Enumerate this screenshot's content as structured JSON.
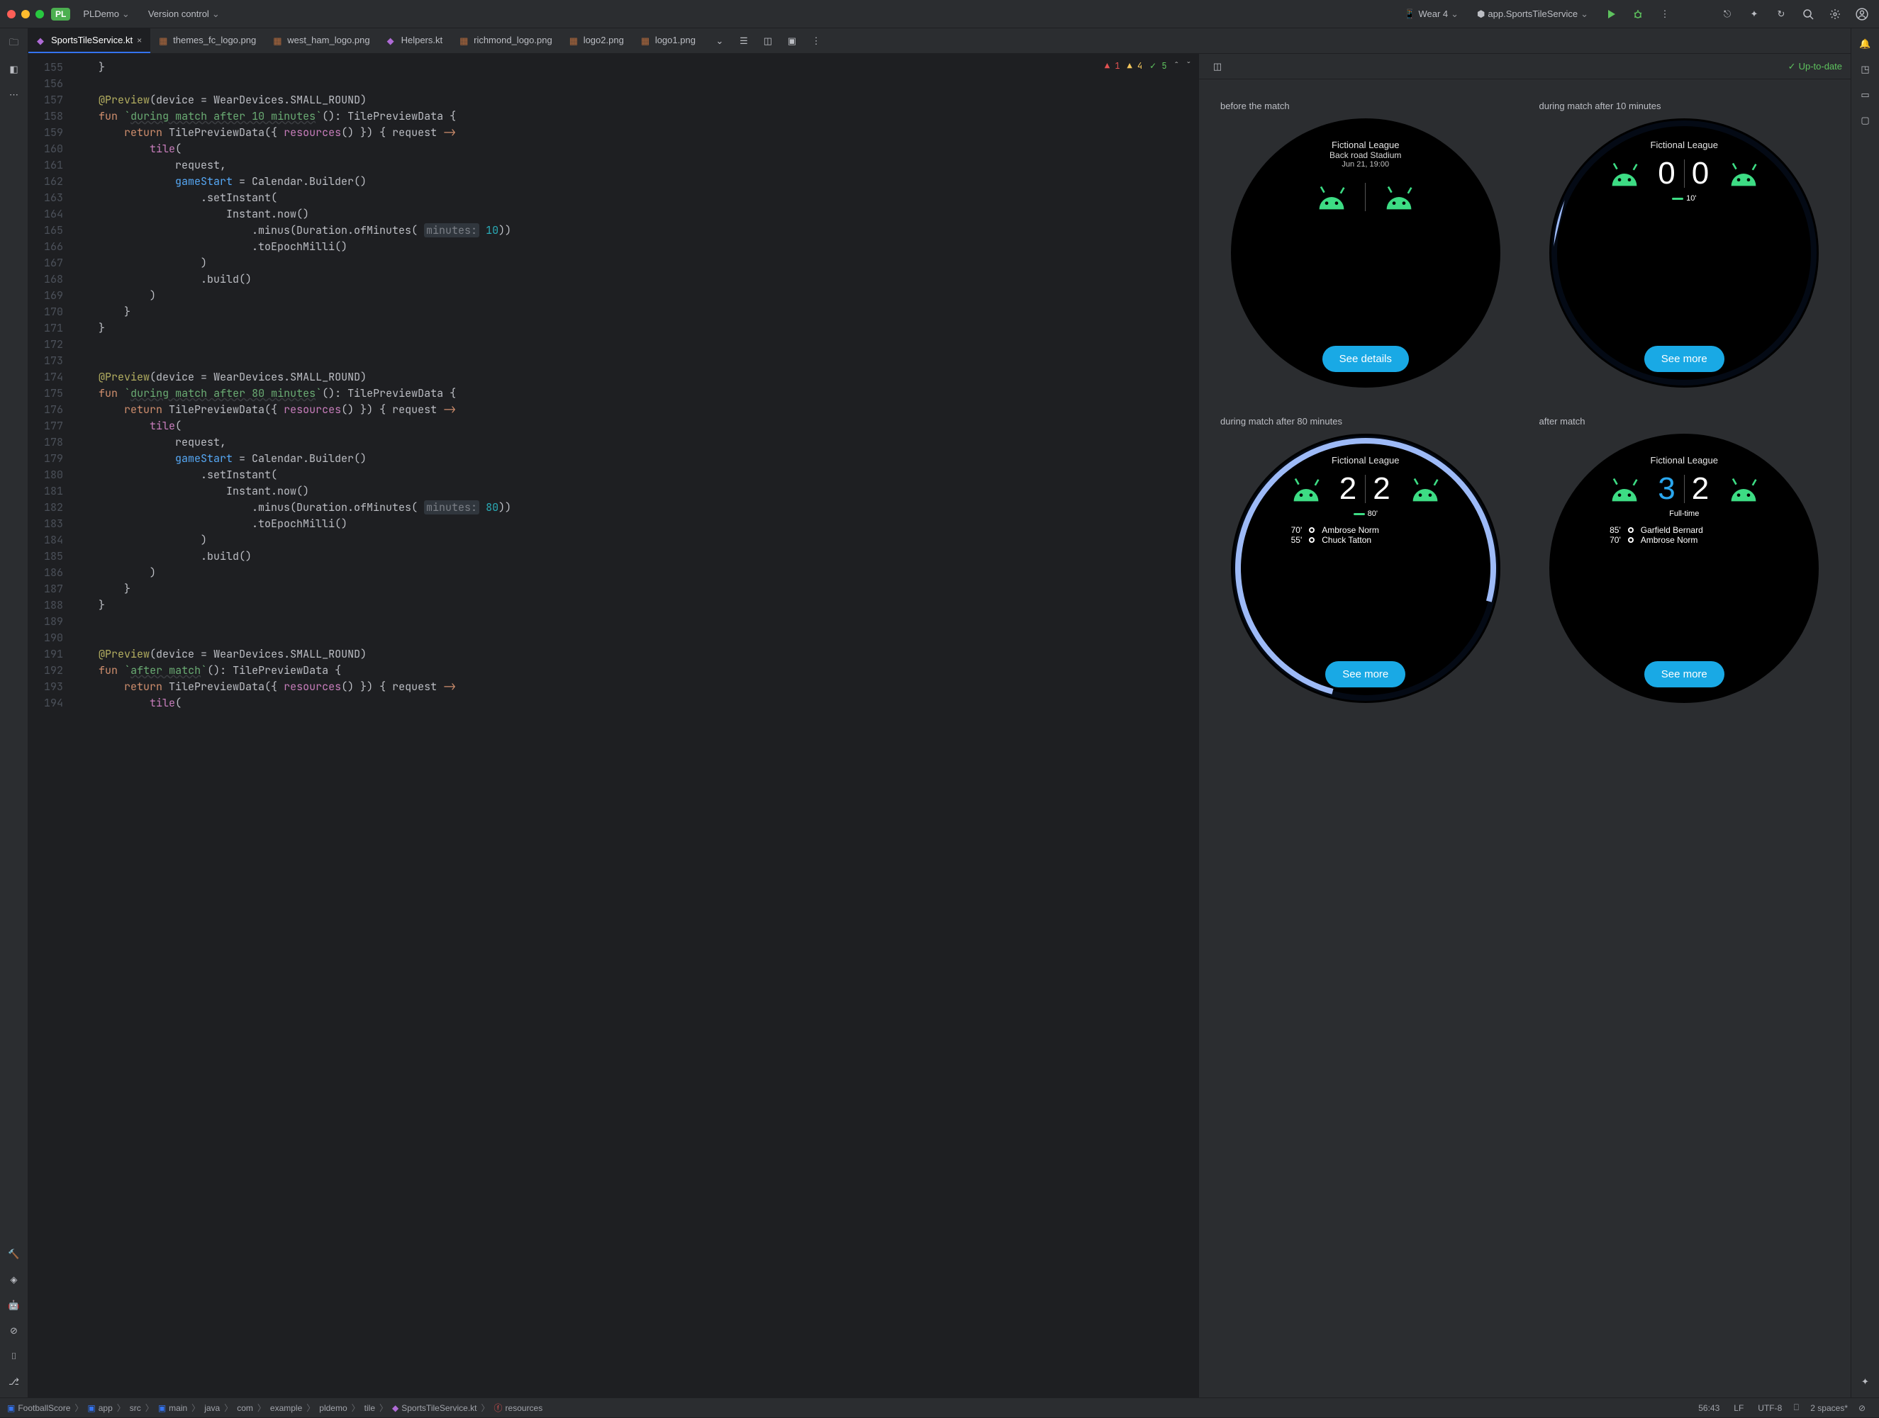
{
  "titlebar": {
    "project_badge": "PL",
    "project_name": "PLDemo",
    "vcs_label": "Version control",
    "device_label": "Wear 4",
    "run_config": "app.SportsTileService"
  },
  "tabs": [
    {
      "label": "SportsTileService.kt",
      "type": "kt",
      "active": true
    },
    {
      "label": "themes_fc_logo.png",
      "type": "img"
    },
    {
      "label": "west_ham_logo.png",
      "type": "img"
    },
    {
      "label": "Helpers.kt",
      "type": "kt"
    },
    {
      "label": "richmond_logo.png",
      "type": "img"
    },
    {
      "label": "logo2.png",
      "type": "img"
    },
    {
      "label": "logo1.png",
      "type": "img"
    }
  ],
  "inspections": {
    "errors": "1",
    "warnings": "4",
    "oks": "5"
  },
  "gutter_start": 155,
  "gutter_end": 194,
  "preview": {
    "status": "Up-to-date",
    "tiles": [
      {
        "title": "before the match",
        "league": "Fictional League",
        "venue": "Back road Stadium",
        "date": "Jun 21, 19:00",
        "button": "See details"
      },
      {
        "title": "during match after 10 minutes",
        "league": "Fictional League",
        "score_l": "0",
        "score_r": "0",
        "minute": "10'",
        "button": "See more"
      },
      {
        "title": "during match after 80 minutes",
        "league": "Fictional League",
        "score_l": "2",
        "score_r": "2",
        "minute": "80'",
        "button": "See more",
        "scorers": [
          {
            "t": "70'",
            "n": "Ambrose Norm"
          },
          {
            "t": "55'",
            "n": "Chuck Tatton"
          }
        ]
      },
      {
        "title": "after match",
        "league": "Fictional League",
        "score_l": "3",
        "score_r": "2",
        "ft": "Full-time",
        "button": "See more",
        "scorers": [
          {
            "t": "85'",
            "n": "Garfield Bernard"
          },
          {
            "t": "70'",
            "n": "Ambrose Norm"
          }
        ]
      }
    ]
  },
  "breadcrumbs": [
    "FootballScore",
    "app",
    "src",
    "main",
    "java",
    "com",
    "example",
    "pldemo",
    "tile",
    "SportsTileService.kt",
    "resources"
  ],
  "statusbar": {
    "pos": "56:43",
    "le": "LF",
    "enc": "UTF-8",
    "indent": "2 spaces*"
  },
  "code": {
    "preview_device": "WearDevices.SMALL_ROUND",
    "fn1": "during match after 10 minutes",
    "fn2": "during match after 80 minutes",
    "fn3": "after match",
    "min_hint": "minutes:",
    "min1": "10",
    "min2": "80"
  }
}
